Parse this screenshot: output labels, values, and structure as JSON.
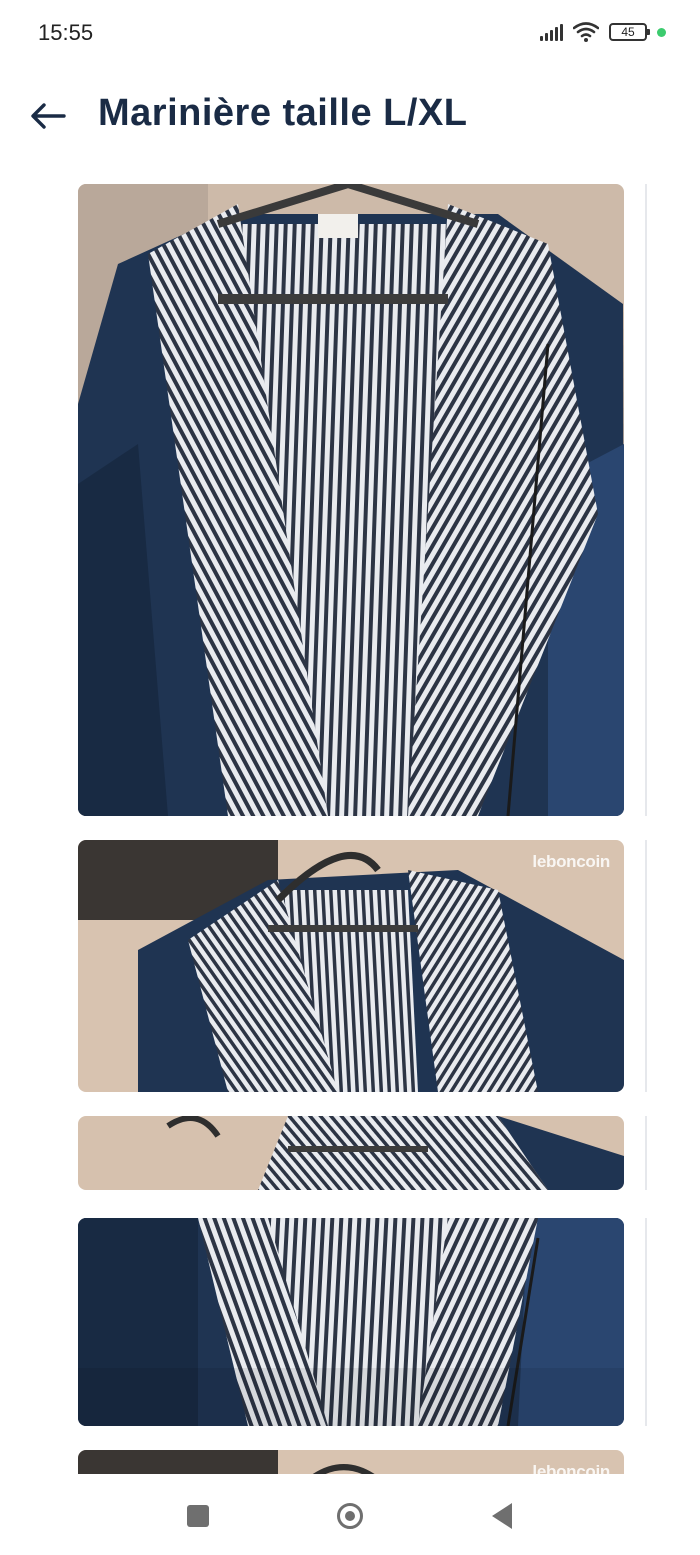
{
  "status_bar": {
    "time": "15:55",
    "battery": "45",
    "icons": [
      "signal-icon",
      "wifi-icon",
      "battery-icon",
      "green-dot-indicator"
    ]
  },
  "header": {
    "back_icon": "arrow-left-icon",
    "title": "Marinière taille L/XL"
  },
  "gallery": {
    "photos": [
      {
        "name": "photo-1",
        "watermark": ""
      },
      {
        "name": "photo-2",
        "watermark": "leboncoin"
      },
      {
        "name": "photo-3",
        "watermark": ""
      },
      {
        "name": "photo-4",
        "watermark": ""
      },
      {
        "name": "photo-5",
        "watermark": "leboncoin"
      }
    ]
  },
  "nav": {
    "items": [
      "recent-apps-icon",
      "home-icon",
      "back-triangle-icon"
    ]
  },
  "colors": {
    "title": "#1a2b45",
    "jacket_navy": "#1f3452",
    "stripe_dark": "#2b3342",
    "stripe_light": "#e8eaee",
    "background_wall": "#d9c4b2",
    "status_dot": "#3ccb6e"
  }
}
